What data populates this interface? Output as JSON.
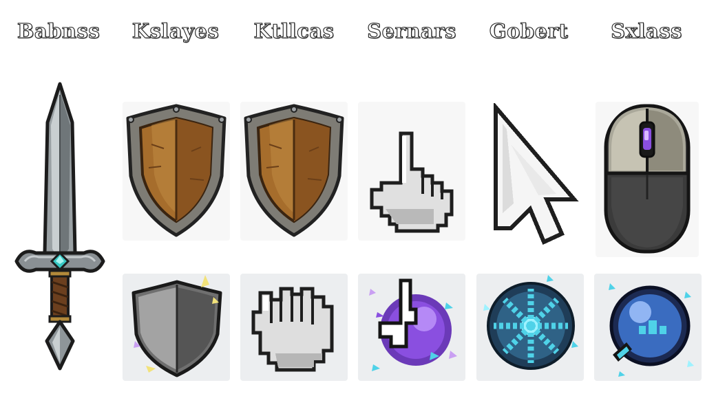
{
  "headers": [
    "Babnss",
    "Kslayes",
    "Ktllcas",
    "Sernars",
    "Gobert",
    "Sxlass"
  ],
  "icons": {
    "row1": [
      "sword-icon",
      "wooden-shield-icon",
      "wooden-shield-icon",
      "pointing-hand-cursor-icon",
      "arrow-cursor-icon",
      "computer-mouse-icon"
    ],
    "row2": [
      "steel-shield-icon",
      "grab-hand-cursor-icon",
      "arcane-hand-orb-icon",
      "frost-burst-orb-icon",
      "crystal-orb-cursor-icon"
    ]
  },
  "colors": {
    "wood": "#a66d2c",
    "metal": "#6f6f6f",
    "arcane": "#8a4fe0",
    "frost": "#4fd2e8",
    "orb_blue": "#3a6cc0"
  }
}
